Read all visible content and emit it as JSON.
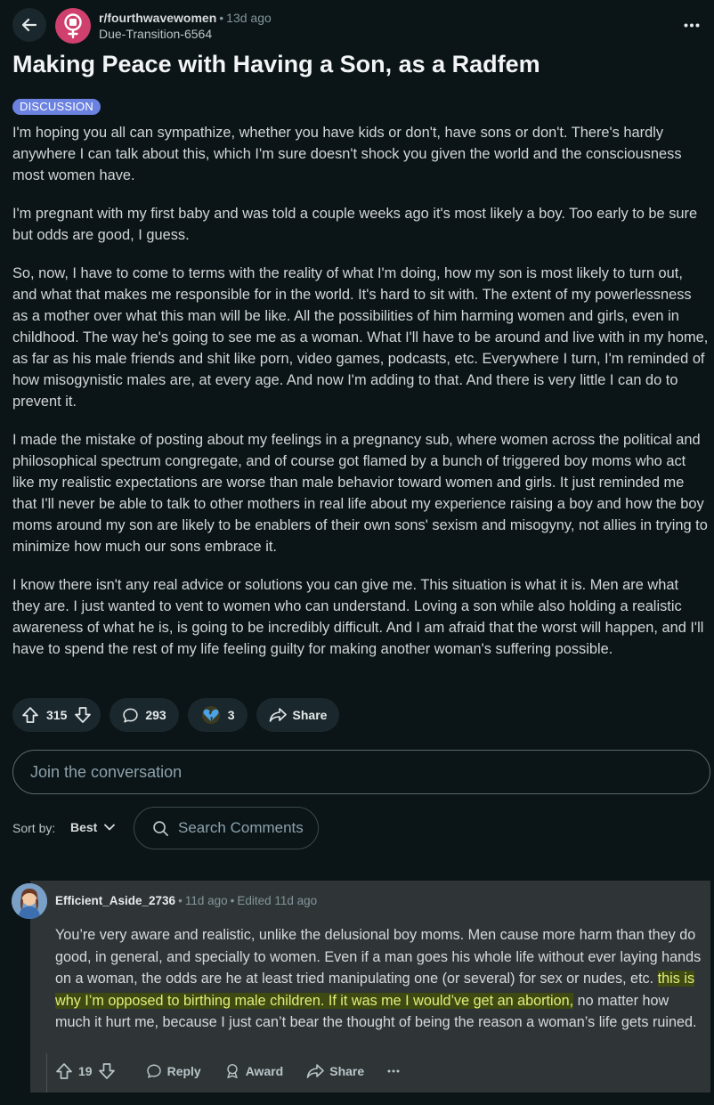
{
  "header": {
    "subreddit": "r/fourthwavewomen",
    "age": "13d ago",
    "author": "Due-Transition-6564"
  },
  "post": {
    "title": "Making Peace with Having a Son, as a Radfem",
    "flair": "DISCUSSION",
    "paragraphs": [
      "I'm hoping you all can sympathize, whether you have kids or don't, have sons or don't. There's hardly anywhere I can talk about this, which I'm sure doesn't shock you given the world and the consciousness most women have.",
      "I'm pregnant with my first baby and was told a couple weeks ago it's most likely a boy. Too early to be sure but odds are good, I guess.",
      "So, now, I have to come to terms with the reality of what I'm doing, how my son is most likely to turn out, and what that makes me responsible for in the world. It's hard to sit with. The extent of my powerlessness as a mother over what this man will be like. All the possibilities of him harming women and girls, even in childhood. The way he's going to see me as a woman. What I'll have to be around and live with in my home, as far as his male friends and shit like porn, video games, podcasts, etc. Everywhere I turn, I'm reminded of how misogynistic males are, at every age. And now I'm adding to that. And there is very little I can do to prevent it.",
      "I made the mistake of posting about my feelings in a pregnancy sub, where women across the political and philosophical spectrum congregate, and of course got flamed by a bunch of triggered boy moms who act like my realistic expectations are worse than male behavior toward women and girls. It just reminded me that I'll never be able to talk to other mothers in real life about my experience raising a boy and how the boy moms around my son are likely to be enablers of their own sons' sexism and misogyny, not allies in trying to minimize how much our sons embrace it.",
      "I know there isn't any real advice or solutions you can give me. This situation is what it is. Men are what they are. I just wanted to vent to women who can understand. Loving a son while also holding a realistic awareness of what he is, is going to be incredibly difficult. And I am afraid that the worst will happen, and I'll have to spend the rest of my life feeling guilty for making another woman's suffering possible."
    ]
  },
  "actions": {
    "votes": "315",
    "comments": "293",
    "awards": "3",
    "share": "Share"
  },
  "join_placeholder": "Join the conversation",
  "sort": {
    "label": "Sort by:",
    "value": "Best"
  },
  "search_placeholder": "Search Comments",
  "comment": {
    "author": "Efficient_Aside_2736",
    "age": "11d ago",
    "edited": "Edited 11d ago",
    "text_before": "You’re very aware and realistic, unlike the delusional boy moms. Men cause more harm than they do good, in general, and specially to women. Even if a man goes his whole life without ever laying hands on a woman, the odds are he at least tried manipulating one (or several) for sex or nudes, etc.",
    "text_highlight": "this is why I’m opposed to birthing male children. If it was me I would’ve get an abortion,",
    "text_after": "no matter how much it hurt me, because I just can’t bear the thought of being the reason a woman’s life gets ruined.",
    "votes": "19",
    "reply": "Reply",
    "award": "Award",
    "share": "Share"
  },
  "colors": {
    "background": "#0b1416",
    "pill": "#1a282d",
    "flair": "#6b82e0",
    "subreddit_icon": "#d0406e",
    "comment_bg": "#2f3436",
    "highlight": "#3f4a12"
  },
  "icons": [
    "back-arrow-icon",
    "venus-fist-icon",
    "more-icon",
    "upvote-icon",
    "downvote-icon",
    "comment-bubble-icon",
    "broken-heart-icon",
    "share-icon",
    "chevron-down-icon",
    "search-icon",
    "award-icon"
  ]
}
